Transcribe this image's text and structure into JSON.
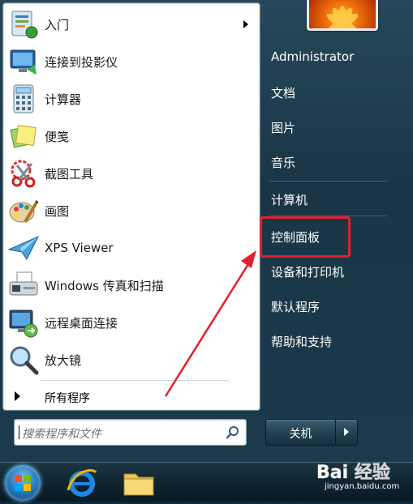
{
  "programs": [
    {
      "label": "入门",
      "icon": "getting-started-icon",
      "has_submenu": true
    },
    {
      "label": "连接到投影仪",
      "icon": "projector-icon",
      "has_submenu": false
    },
    {
      "label": "计算器",
      "icon": "calculator-icon",
      "has_submenu": false
    },
    {
      "label": "便笺",
      "icon": "sticky-notes-icon",
      "has_submenu": false
    },
    {
      "label": "截图工具",
      "icon": "snipping-tool-icon",
      "has_submenu": false
    },
    {
      "label": "画图",
      "icon": "paint-icon",
      "has_submenu": false
    },
    {
      "label": "XPS Viewer",
      "icon": "xps-viewer-icon",
      "has_submenu": false
    },
    {
      "label": "Windows 传真和扫描",
      "icon": "fax-scan-icon",
      "has_submenu": false
    },
    {
      "label": "远程桌面连接",
      "icon": "remote-desktop-icon",
      "has_submenu": false
    },
    {
      "label": "放大镜",
      "icon": "magnifier-icon",
      "has_submenu": false
    }
  ],
  "all_programs": {
    "label": "所有程序"
  },
  "search": {
    "placeholder": "搜索程序和文件"
  },
  "right_panel": {
    "user_name": "Administrator",
    "items": [
      "文档",
      "图片",
      "音乐",
      "计算机",
      "控制面板",
      "设备和打印机",
      "默认程序",
      "帮助和支持"
    ]
  },
  "shutdown": {
    "label": "关机"
  },
  "watermark": {
    "logo": "Bai 经验",
    "url": "jingyan.baidu.com"
  },
  "colors": {
    "highlight": "#e3202a",
    "arrow": "#e3202a",
    "panel_bg": "#1c3a4c"
  }
}
